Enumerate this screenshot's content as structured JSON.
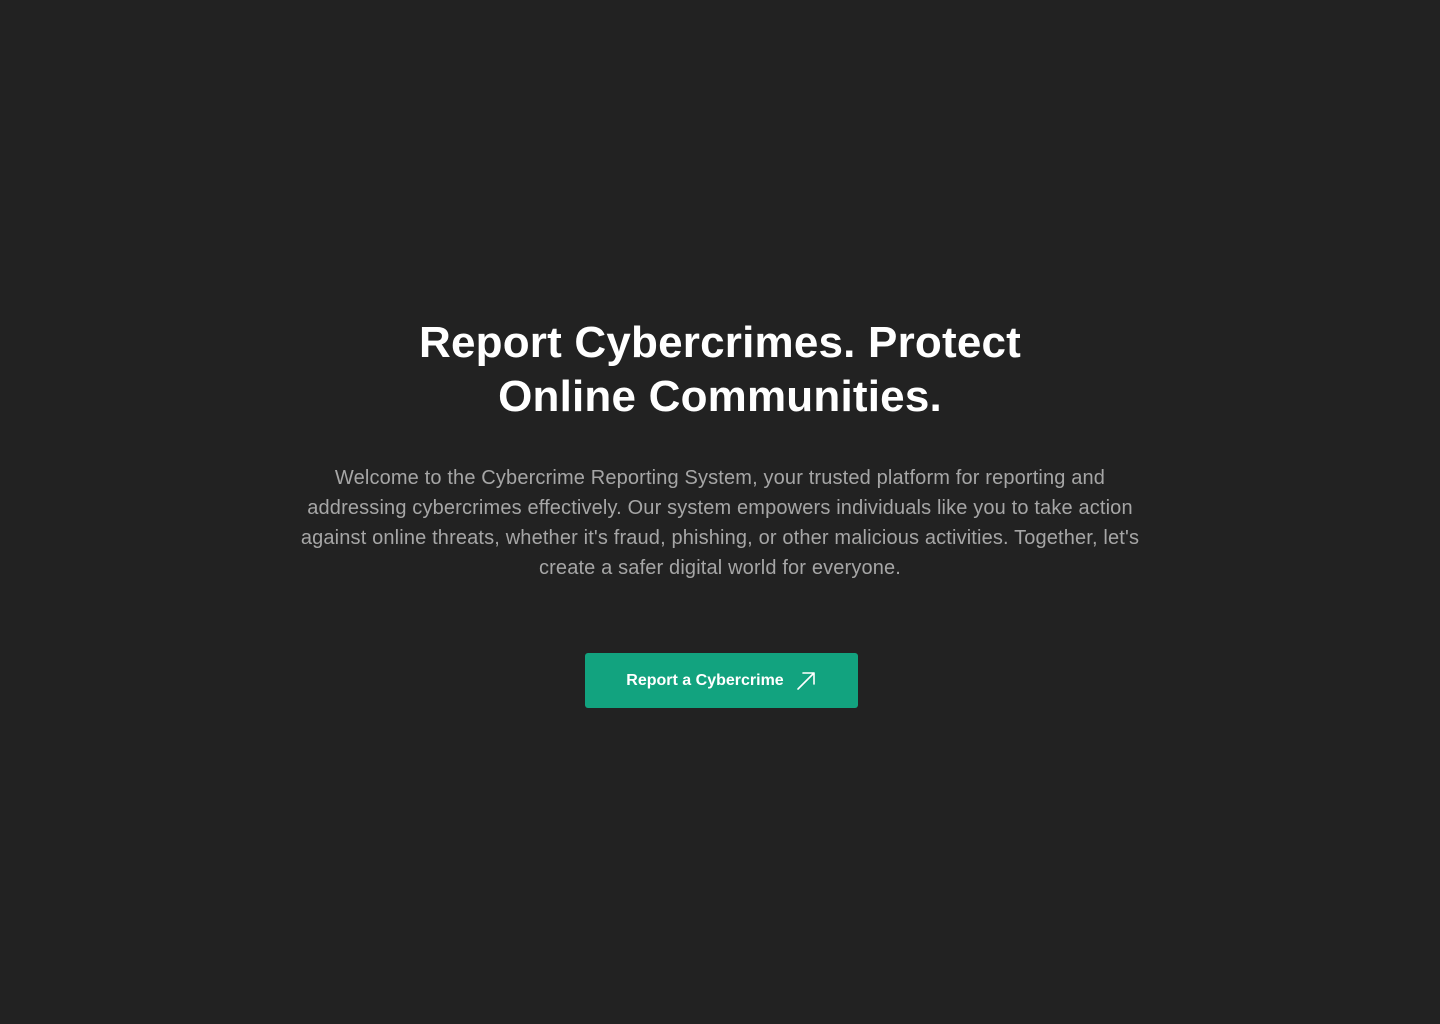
{
  "hero": {
    "title": "Report Cybercrimes. Protect Online Communities.",
    "description": "Welcome to the Cybercrime Reporting System, your trusted platform for reporting and addressing cybercrimes effectively. Our system empowers individuals like you to take action against online threats, whether it's fraud, phishing, or other malicious activities. Together, let's create a safer digital world for everyone.",
    "cta": {
      "label": "Report a Cybercrime",
      "icon": "arrow-up-right-icon"
    }
  },
  "colors": {
    "background": "#222222",
    "title": "#ffffff",
    "description": "#a6a6a6",
    "accent": "#12a37f"
  }
}
